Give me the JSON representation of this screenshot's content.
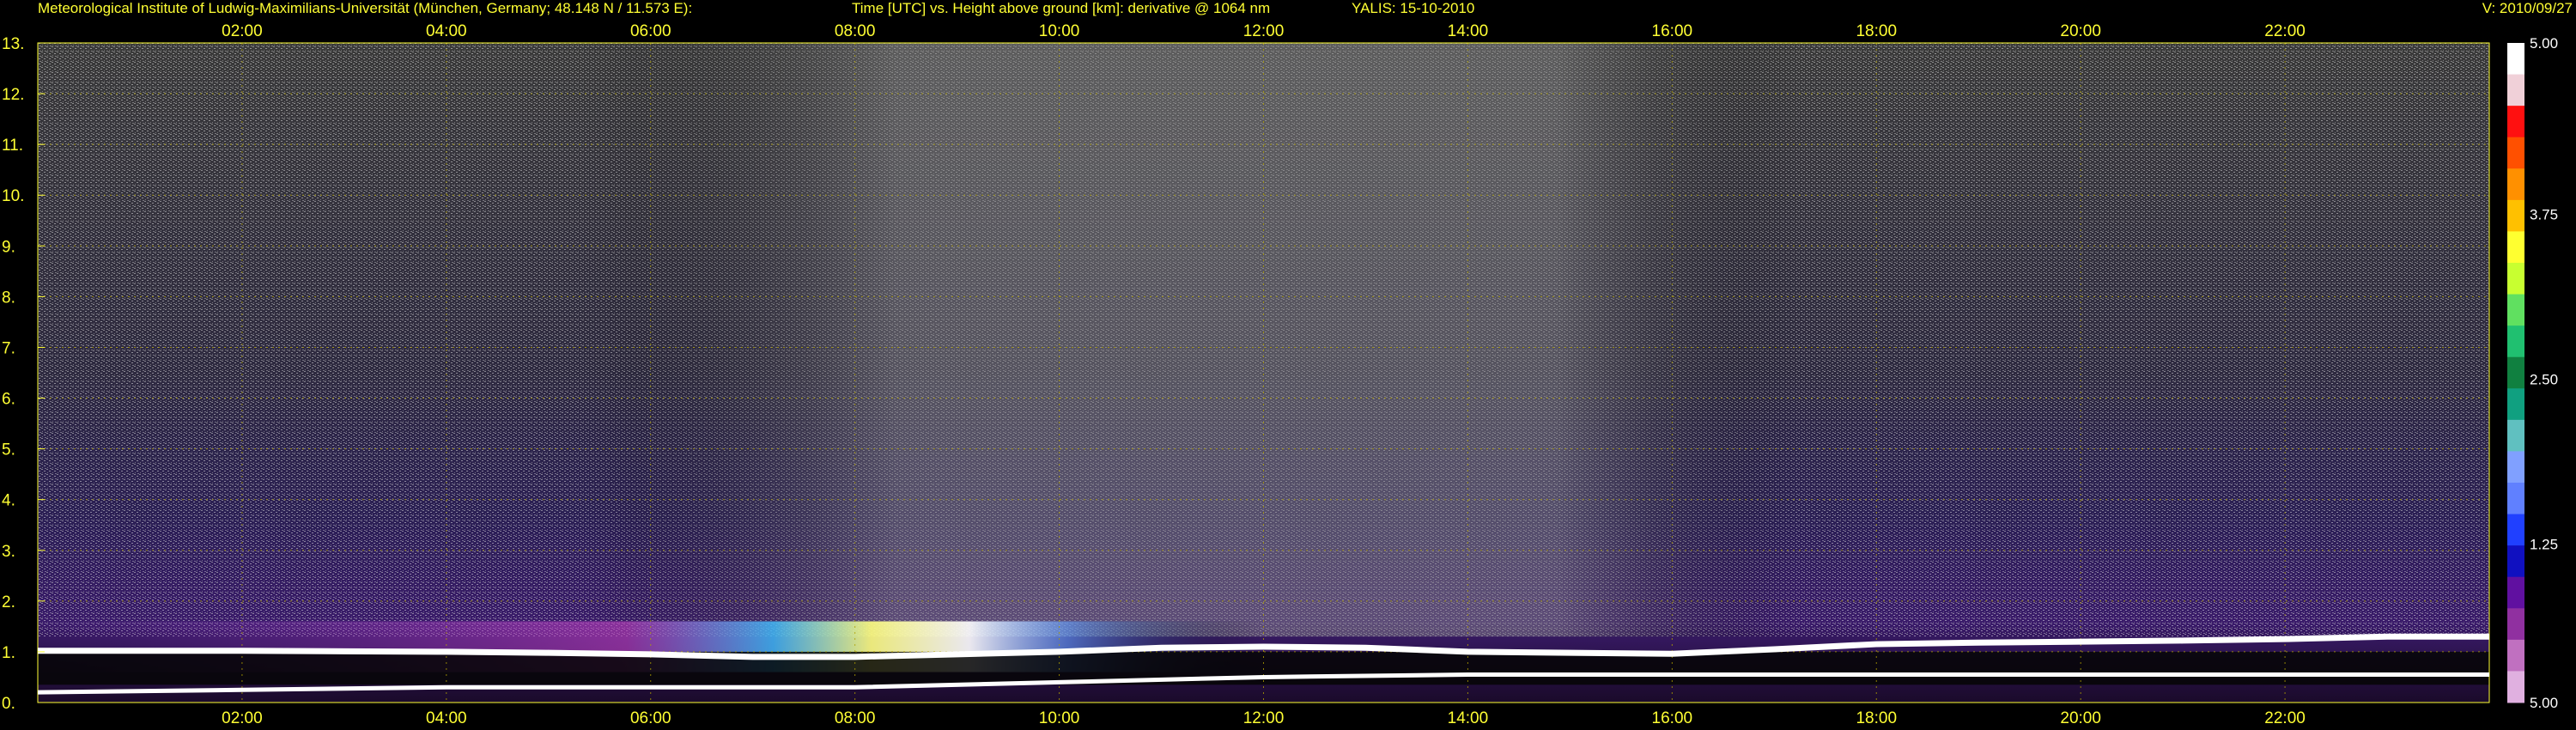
{
  "header": {
    "institute": "Meteorological Institute of Ludwig-Maximilians-Universität (München, Germany; 48.148 N / 11.573 E):",
    "title": "Time [UTC] vs. Height above ground [km]: derivative @ 1064 nm",
    "station": "YALIS: 15-10-2010",
    "version": "V: 2010/09/27"
  },
  "chart_data": {
    "type": "heatmap",
    "title": "Time [UTC] vs. Height above ground [km]: derivative @ 1064 nm",
    "xlabel": "Time [UTC]",
    "ylabel": "Height above ground [km]",
    "x_ticks": [
      "02:00",
      "04:00",
      "06:00",
      "08:00",
      "10:00",
      "12:00",
      "14:00",
      "16:00",
      "18:00",
      "20:00",
      "22:00"
    ],
    "x_tick_hours": [
      2,
      4,
      6,
      8,
      10,
      12,
      14,
      16,
      18,
      20,
      22
    ],
    "xlim_hours": [
      0,
      24
    ],
    "y_ticks": [
      "0.",
      "1.",
      "2.",
      "3.",
      "4.",
      "5.",
      "6.",
      "7.",
      "8.",
      "9.",
      "10.",
      "11.",
      "12.",
      "13."
    ],
    "y_tick_values": [
      0,
      1,
      2,
      3,
      4,
      5,
      6,
      7,
      8,
      9,
      10,
      11,
      12,
      13
    ],
    "ylim": [
      0,
      13
    ],
    "grid": true,
    "colorbar": {
      "labels": [
        "5.00",
        "3.75",
        "2.50",
        "1.25",
        "5.00"
      ],
      "label_values": [
        5.0,
        3.75,
        2.5,
        1.25,
        -5.0
      ],
      "colors": [
        "#ffffff",
        "#f0d0d8",
        "#ff1010",
        "#ff5000",
        "#ff9000",
        "#ffc000",
        "#ffff30",
        "#c8ff30",
        "#60e060",
        "#20c070",
        "#108040",
        "#10a080",
        "#60c0c0",
        "#80a0ff",
        "#6080ff",
        "#2040ff",
        "#1010c0",
        "#6010a0",
        "#9030a0",
        "#c070c0",
        "#e0b0e0"
      ]
    },
    "features": [
      {
        "name": "boundary layer top (white line)",
        "points_hours": [
          0,
          1,
          2,
          3,
          4,
          5,
          6,
          7,
          8,
          9,
          10,
          11,
          12,
          13,
          14,
          15,
          16,
          17,
          18,
          19,
          20,
          21,
          22,
          23,
          24
        ],
        "heights_km": [
          1.02,
          1.02,
          1.02,
          1.01,
          1.0,
          0.98,
          0.95,
          0.9,
          0.9,
          0.95,
          1.0,
          1.08,
          1.1,
          1.08,
          1.0,
          0.98,
          0.96,
          1.05,
          1.15,
          1.18,
          1.2,
          1.22,
          1.25,
          1.3,
          1.3
        ]
      },
      {
        "name": "surface layer line (white)",
        "points_hours": [
          0,
          2,
          4,
          6,
          8,
          10,
          12,
          14,
          16,
          18,
          20,
          22,
          24
        ],
        "heights_km": [
          0.2,
          0.25,
          0.3,
          0.3,
          0.3,
          0.4,
          0.5,
          0.55,
          0.55,
          0.55,
          0.55,
          0.55,
          0.55
        ]
      }
    ]
  }
}
